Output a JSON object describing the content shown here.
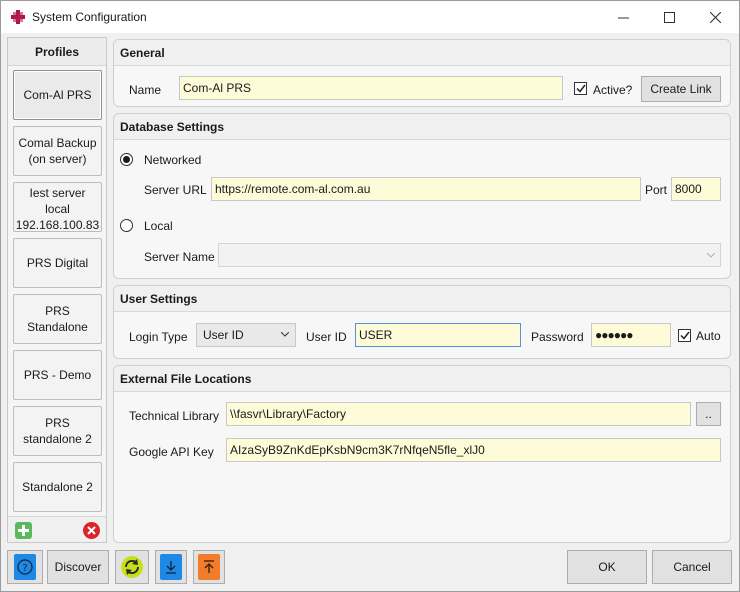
{
  "window": {
    "title": "System Configuration",
    "controls": {
      "minimize": "minimize-icon",
      "maximize": "maximize-icon",
      "close": "close-icon"
    }
  },
  "profiles": {
    "header": "Profiles",
    "items": [
      {
        "label": "Com-Al PRS",
        "active": true
      },
      {
        "label": "Comal Backup\n(on server)",
        "active": false
      },
      {
        "label": "Iest server\nlocal\n192.168.100.83",
        "active": false
      },
      {
        "label": "PRS Digital",
        "active": false
      },
      {
        "label": "PRS\nStandalone",
        "active": false
      },
      {
        "label": "PRS - Demo",
        "active": false
      },
      {
        "label": "PRS\nstandalone 2",
        "active": false
      },
      {
        "label": "Standalone 2",
        "active": false
      }
    ],
    "add_icon": "plus-icon",
    "remove_icon": "x-icon"
  },
  "general": {
    "header": "General",
    "name_label": "Name",
    "name_value": "Com-Al PRS",
    "active_label": "Active?",
    "active_checked": true,
    "create_link_label": "Create Link"
  },
  "database": {
    "header": "Database Settings",
    "networked_label": "Networked",
    "networked_selected": true,
    "server_url_label": "Server URL",
    "server_url_value": "https://remote.com-al.com.au",
    "port_label": "Port",
    "port_value": "8000",
    "local_label": "Local",
    "local_selected": false,
    "server_name_label": "Server Name",
    "server_name_value": ""
  },
  "user": {
    "header": "User Settings",
    "login_type_label": "Login Type",
    "login_type_value": "User ID",
    "user_id_label": "User ID",
    "user_id_value": "USER",
    "password_label": "Password",
    "password_value": "●●●●●●",
    "auto_label": "Auto",
    "auto_checked": true
  },
  "files": {
    "header": "External File Locations",
    "tech_library_label": "Technical Library",
    "tech_library_value": "\\\\fasvr\\Library\\Factory",
    "browse_label": "..",
    "google_api_label": "Google API Key",
    "google_api_value": "AIzaSyB9ZnKdEpKsbN9cm3K7rNfqeN5fle_xlJ0"
  },
  "footer": {
    "help_icon": "question-icon",
    "discover_label": "Discover",
    "refresh_icon": "refresh-icon",
    "import_icon": "download-icon",
    "export_icon": "upload-icon",
    "ok_label": "OK",
    "cancel_label": "Cancel"
  },
  "colors": {
    "field_bg": "#fefbd8",
    "accent_green": "#5cb85c",
    "accent_red": "#d9252b",
    "accent_blue": "#1e88e5",
    "accent_orange": "#f07c2c"
  }
}
